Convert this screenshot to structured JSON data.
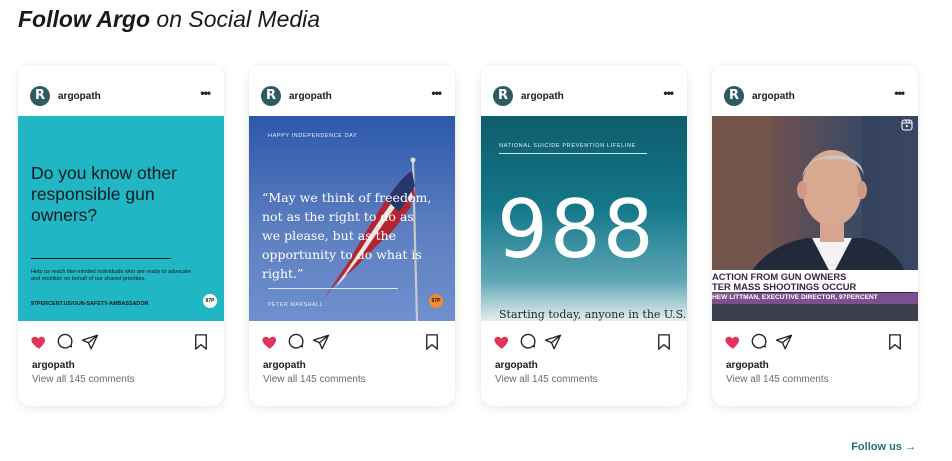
{
  "section": {
    "title_bold": "Follow Argo",
    "title_rest": " on Social Media",
    "follow_label": "Follow us",
    "follow_arrow": "→"
  },
  "brand": {
    "avatar_letter": "R",
    "avatar_color": "#2d5b62",
    "like_color": "#e2335a",
    "link_color": "#1f6f78"
  },
  "posts": [
    {
      "username": "argopath",
      "more": "•••",
      "footer_user": "argopath",
      "comments": "View all 145 comments",
      "media": {
        "headline": "Do you know other responsible gun owners?",
        "body": "Help us reach like-minded individuals who are ready to advocate and mobilize on behalf of our shared priorities.",
        "url": "97PERCENT.US/GUN-SAFETY-AMBASSADOR",
        "badge": "97P",
        "background": "#21b6c4"
      }
    },
    {
      "username": "argopath",
      "more": "•••",
      "footer_user": "argopath",
      "comments": "View all 145 comments",
      "media": {
        "top": "HAPPY INDEPENDENCE DAY",
        "quote": "“May we think of freedom, not as the right to do as we please, but as the opportunity to do what is right.”",
        "author": "PETER MARSHALL",
        "badge": "97P"
      }
    },
    {
      "username": "argopath",
      "more": "•••",
      "footer_user": "argopath",
      "comments": "View all 145 comments",
      "media": {
        "top": "NATIONAL SUICIDE PREVENTION LIFELINE",
        "number": "988",
        "bottom": "Starting today, anyone in the U.S."
      }
    },
    {
      "username": "argopath",
      "more": "•••",
      "footer_user": "argopath",
      "comments": "View all 145 comments",
      "media": {
        "line1": "ACTION FROM GUN OWNERS",
        "line2": "TER MASS SHOOTINGS OCCUR",
        "line3": "HEW LITTMAN, EXECUTIVE DIRECTOR, 97PERCENT",
        "icon": "reels-icon"
      }
    }
  ],
  "icons": [
    "heart-icon",
    "comment-icon",
    "share-icon",
    "bookmark-icon",
    "more-icon",
    "arrow-right-icon"
  ]
}
